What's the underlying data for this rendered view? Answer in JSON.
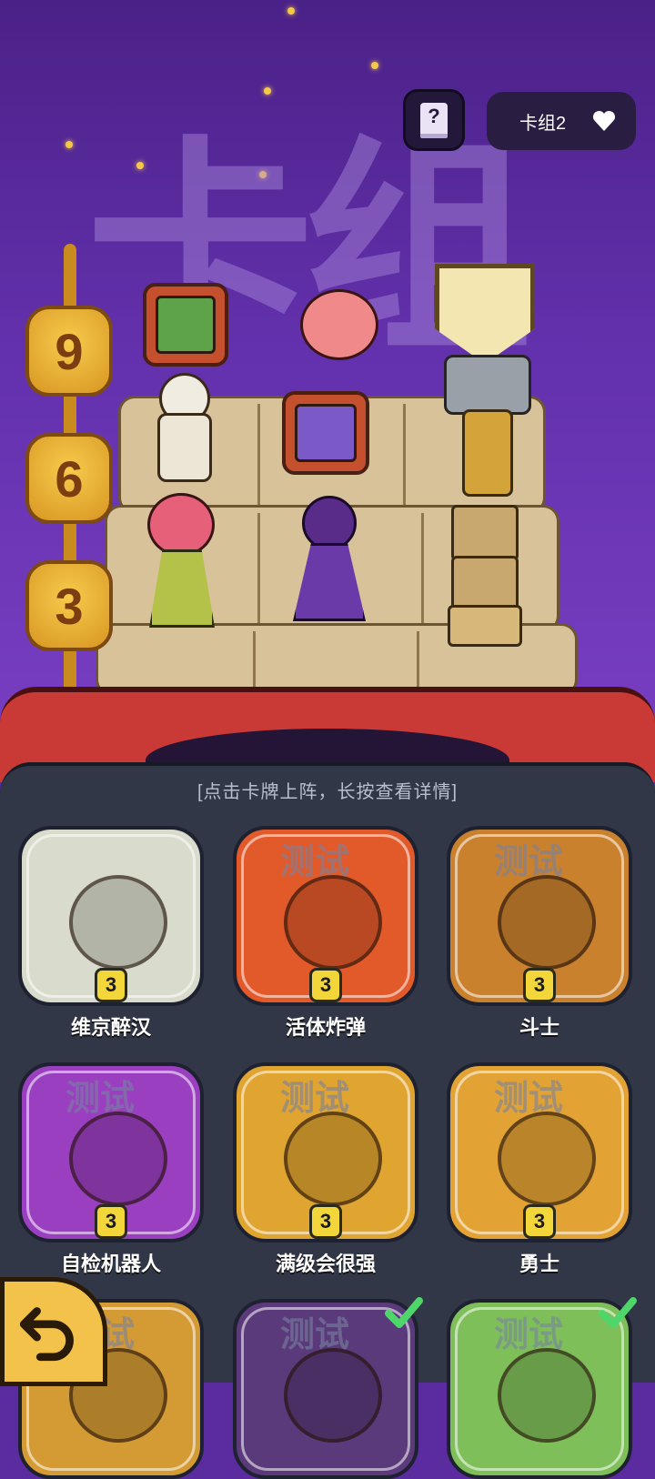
{
  "header": {
    "bg_title": "卡组",
    "help_icon": "book-question-icon",
    "deck_selector": {
      "label": "卡组2",
      "icon": "heart-icon"
    }
  },
  "counter": {
    "digits": [
      "9",
      "6",
      "3"
    ]
  },
  "panel": {
    "hint": "[点击卡牌上阵，长按查看详情]",
    "watermark": "测试",
    "cards": [
      {
        "name": "维京醉汉",
        "level": "3",
        "watermark": false,
        "selected": false,
        "bg": "#d9dccd"
      },
      {
        "name": "活体炸弹",
        "level": "3",
        "watermark": true,
        "selected": false,
        "bg": "#e25a2a"
      },
      {
        "name": "斗士",
        "level": "3",
        "watermark": true,
        "selected": false,
        "bg": "#c9812e"
      },
      {
        "name": "自检机器人",
        "level": "3",
        "watermark": true,
        "selected": false,
        "bg": "#9a3fc0"
      },
      {
        "name": "满级会很强",
        "level": "3",
        "watermark": true,
        "selected": false,
        "bg": "#e0a430"
      },
      {
        "name": "勇士",
        "level": "3",
        "watermark": true,
        "selected": false,
        "bg": "#e3a334"
      },
      {
        "name": "",
        "level": "",
        "watermark": true,
        "selected": false,
        "bg": "#d49a34"
      },
      {
        "name": "",
        "level": "",
        "watermark": true,
        "selected": true,
        "bg": "#5a3a7a"
      },
      {
        "name": "",
        "level": "",
        "watermark": true,
        "selected": true,
        "bg": "#7fbf5a"
      }
    ]
  },
  "footer": {
    "back_icon": "undo-arrow-icon"
  },
  "colors": {
    "accent": "#f2d63a",
    "panel": "#313747",
    "scene": "#6331ad"
  }
}
